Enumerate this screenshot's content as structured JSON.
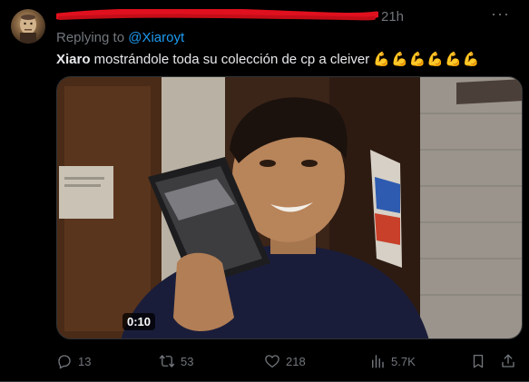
{
  "tweet": {
    "time": "21h",
    "more_icon": "more-dots-icon",
    "replying_prefix": "Replying to ",
    "replying_handle": "@Xiaroyt",
    "text_bold": "Xiaro",
    "text_rest": " mostrándole toda su colección de cp a cleiver ",
    "emojis": "💪💪💪💪💪💪",
    "media": {
      "duration": "0:10"
    },
    "actions": {
      "reply_count": "13",
      "retweet_count": "53",
      "like_count": "218",
      "views_count": "5.7K"
    }
  },
  "colors": {
    "background": "#000000",
    "text": "#e7e9ea",
    "muted": "#71767b",
    "link": "#1d9bf0",
    "redaction": "#e0101e"
  }
}
